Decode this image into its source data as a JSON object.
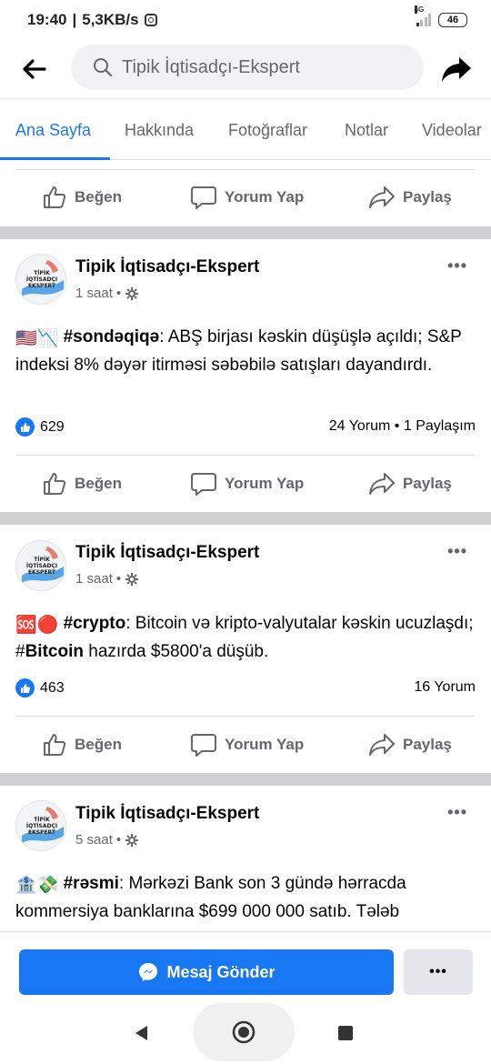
{
  "status": {
    "time": "19:40",
    "speed": "5,3KB/s",
    "network": "4G",
    "battery": "46"
  },
  "header": {
    "search_text": "Tipik İqtisadçı-Ekspert"
  },
  "tabs": [
    "Ana Sayfa",
    "Hakkında",
    "Fotoğraflar",
    "Notlar",
    "Videolar"
  ],
  "actions": {
    "like": "Beğen",
    "comment": "Yorum Yap",
    "share": "Paylaş"
  },
  "avatar_text": "TİPİK İQTİSADÇI EKSPERT",
  "posts": [
    {
      "author": "Tipik İqtisadçı-Ekspert",
      "time": "1 saat",
      "emoji": "🇺🇸📉",
      "tag": "#sondəqiqə",
      "text": ": ABŞ birjası kəskin düşüşlə açıldı; S&P indeksi 8% dəyər itirməsi səbəbilə satışları dayandırdı.",
      "likes": "629",
      "counts": "24 Yorum • 1 Paylaşım"
    },
    {
      "author": "Tipik İqtisadçı-Ekspert",
      "time": "1 saat",
      "emoji": "🆘🔴",
      "tag": "#crypto",
      "text_a": ": Bitcoin və kripto-valyutalar kəskin ucuzlaşdı; #",
      "bold_word": "Bitcoin",
      "text_b": " hazırda $5800'a düşüb.",
      "likes": "463",
      "counts": "16 Yorum"
    },
    {
      "author": "Tipik İqtisadçı-Ekspert",
      "time": "5 saat",
      "emoji": "🏦💸",
      "tag": "#rəsmi",
      "text": ": Mərkəzi Bank son 3 gündə hərracda kommersiya banklarına $699 000 000 satıb. Tələb"
    }
  ],
  "bottom": {
    "message_button": "Mesaj Gönder",
    "more": "•••"
  },
  "colors": {
    "accent": "#1877f2",
    "divider": "#ced0d4"
  }
}
